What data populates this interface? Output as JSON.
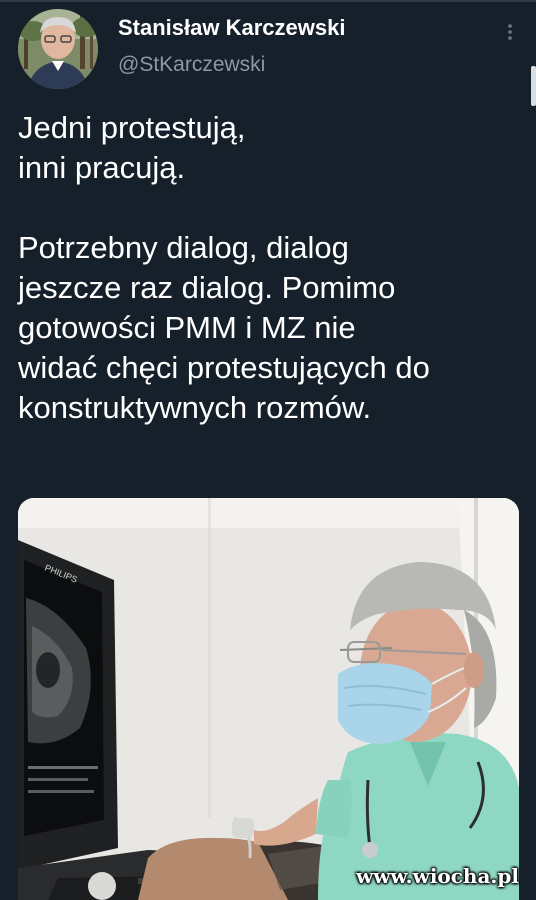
{
  "tweet": {
    "author": {
      "display_name": "Stanisław Karczewski",
      "handle": "@StKarczewski"
    },
    "more_icon": "more-vertical-icon",
    "text_lines": [
      "Jedni protestują,",
      "inni pracują.",
      "",
      "Potrzebny dialog, dialog",
      "jeszcze raz dialog. Pomimo",
      "gotowości PMM i MZ nie",
      "widać chęci protestujących do",
      "konstruktywnych rozmów."
    ],
    "media": {
      "monitor_brand": "PHILIPS",
      "watermark": "www.wiocha.pl"
    }
  },
  "theme": {
    "background": "#15202b",
    "text": "#ffffff",
    "secondary_text": "#8b98a5"
  }
}
